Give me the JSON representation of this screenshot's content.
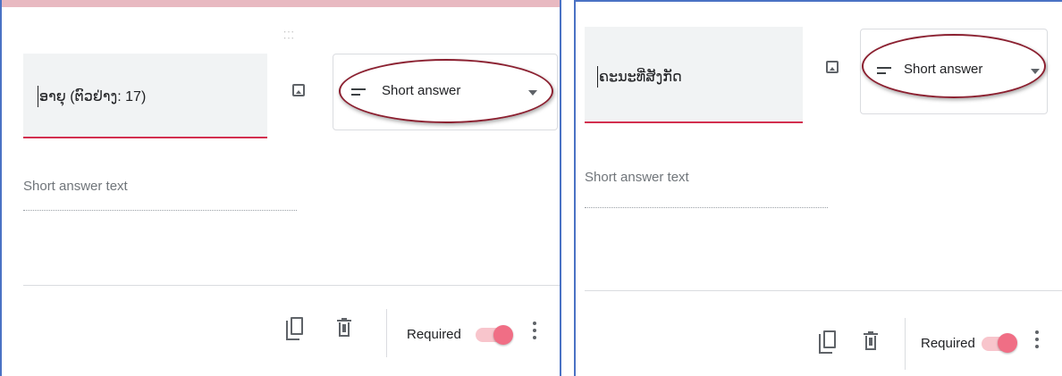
{
  "panels": [
    {
      "question_title": "ອາຍຸ (ຕົວຢ່າງ: 17)",
      "type_selector": {
        "selected": "Short answer",
        "icon": "short-text-lines-icon"
      },
      "answer_placeholder": "Short answer text",
      "footer": {
        "required_label": "Required",
        "required_on": true
      }
    },
    {
      "question_title": "ຄະນະທີ່ສັງກັດ",
      "type_selector": {
        "selected": "Short answer",
        "icon": "short-text-lines-icon"
      },
      "answer_placeholder": "Short answer text",
      "footer": {
        "required_label": "Required",
        "required_on": true
      }
    }
  ],
  "colors": {
    "accent_underline": "#d32f4f",
    "highlight_oval": "#8b2030",
    "toggle_on": "#f06e85",
    "panel_border": "#4a72c4"
  }
}
